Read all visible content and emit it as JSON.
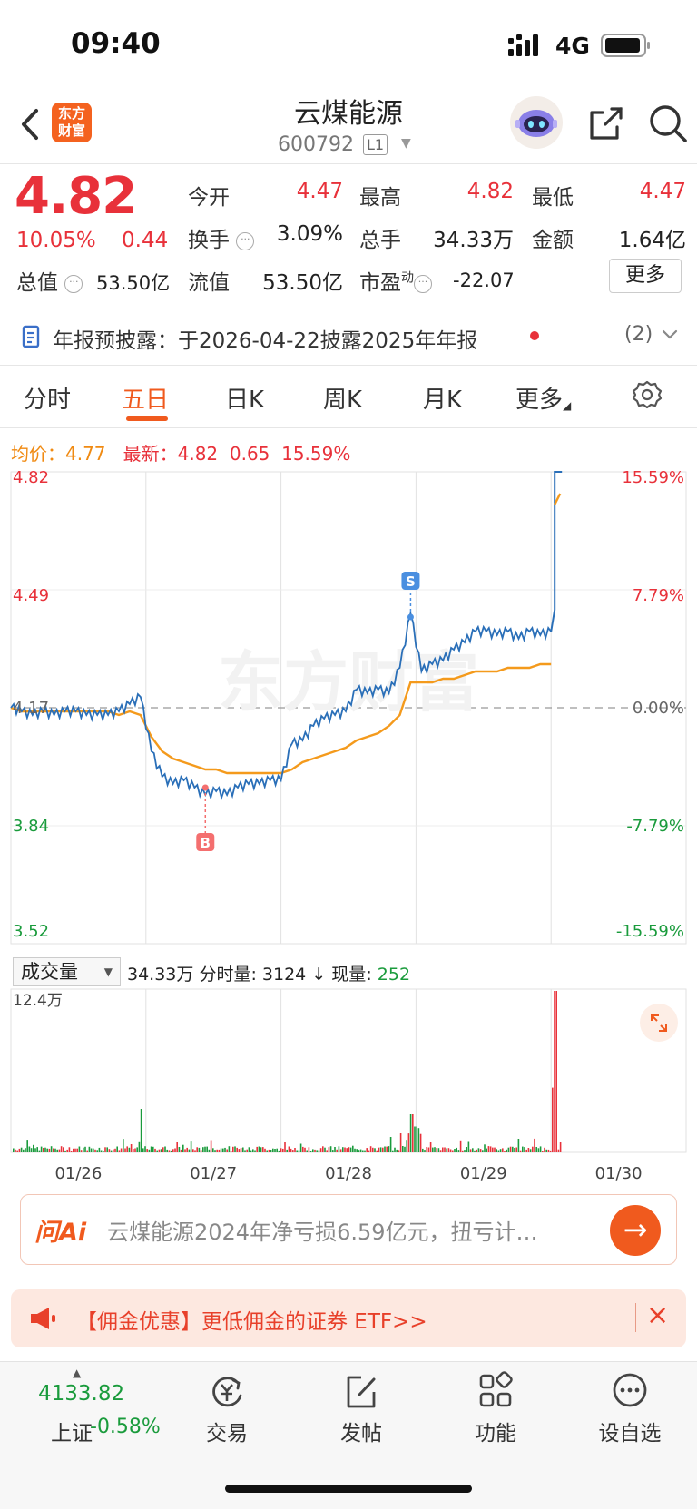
{
  "status_bar": {
    "time": "09:40",
    "network": "4G"
  },
  "header": {
    "logo_text": "东方财富",
    "stock_name": "云煤能源",
    "stock_code": "600792",
    "level": "L1"
  },
  "quote": {
    "price": "4.82",
    "change_pct": "10.05%",
    "change_amt": "0.44",
    "rows": [
      [
        {
          "label": "今开",
          "value": "4.47",
          "color": "red"
        },
        {
          "label": "最高",
          "value": "4.82",
          "color": "red"
        },
        {
          "label": "最低",
          "value": "4.47",
          "color": "red"
        }
      ],
      [
        {
          "label": "换手",
          "value": "3.09%",
          "color": "dark"
        },
        {
          "label": "总手",
          "value": "34.33万",
          "color": "dark"
        },
        {
          "label": "金额",
          "value": "1.64亿",
          "color": "dark"
        }
      ]
    ],
    "market_cap_label": "总值",
    "market_cap": "53.50亿",
    "float_cap_label": "流值",
    "float_cap": "53.50亿",
    "pe_label": "市盈",
    "pe_sup": "动",
    "pe": "-22.07",
    "more_label": "更多"
  },
  "notice": {
    "text": "年报预披露：于2026-04-22披露2025年年报",
    "count": "(2)"
  },
  "tabs": [
    "分时",
    "五日",
    "日K",
    "周K",
    "月K",
    "更多"
  ],
  "active_tab": "五日",
  "chart_legend": {
    "avg_label": "均价：",
    "avg_value": "4.77",
    "latest_label": "最新：",
    "latest_value": "4.82",
    "latest_change": "0.65",
    "latest_pct": "15.59%"
  },
  "colors": {
    "price_line": "#2a6fb8",
    "avg_line": "#f49a1c",
    "up": "#e8313a",
    "down": "#1a9b3c",
    "accent": "#f05a1e"
  },
  "chart_data": {
    "type": "line",
    "title": "",
    "x_dates": [
      "01/26",
      "01/27",
      "01/28",
      "01/29",
      "01/30"
    ],
    "y_ticks_left": [
      "4.82",
      "4.49",
      "4.17",
      "3.84",
      "3.52"
    ],
    "y_ticks_right": [
      "15.59%",
      "7.79%",
      "0.00%",
      "-7.79%",
      "-15.59%"
    ],
    "ylim": [
      3.52,
      4.82
    ],
    "prev_close": 4.17,
    "series": [
      {
        "name": "均价",
        "values": [
          4.17,
          4.16,
          4.16,
          4.16,
          4.16,
          4.16,
          4.16,
          4.16,
          4.16,
          4.16,
          4.15,
          4.16,
          4.15,
          4.09,
          4.05,
          4.03,
          4.02,
          4.01,
          4.0,
          4.0,
          3.99,
          3.99,
          3.99,
          3.99,
          3.99,
          3.99,
          4.0,
          4.02,
          4.03,
          4.04,
          4.05,
          4.06,
          4.08,
          4.09,
          4.1,
          4.12,
          4.15,
          4.24,
          4.24,
          4.24,
          4.25,
          4.25,
          4.26,
          4.27,
          4.27,
          4.27,
          4.28,
          4.28,
          4.28,
          4.29,
          4.29
        ]
      },
      {
        "name": "最新",
        "values": [
          4.17,
          4.16,
          4.15,
          4.16,
          4.15,
          4.16,
          4.16,
          4.15,
          4.15,
          4.15,
          4.16,
          4.18,
          4.2,
          4.05,
          3.98,
          3.96,
          3.97,
          3.95,
          3.93,
          3.94,
          3.93,
          3.95,
          3.96,
          3.96,
          3.97,
          3.97,
          4.07,
          4.08,
          4.12,
          4.14,
          4.15,
          4.16,
          4.22,
          4.21,
          4.22,
          4.21,
          4.28,
          4.43,
          4.27,
          4.29,
          4.3,
          4.33,
          4.35,
          4.38,
          4.38,
          4.37,
          4.38,
          4.36,
          4.38,
          4.37,
          4.38,
          4.82
        ]
      }
    ],
    "markers": [
      {
        "label": "B",
        "price": 3.95
      },
      {
        "label": "S",
        "price": 4.42
      }
    ],
    "volume": {
      "label": "成交量",
      "total": "34.33万",
      "tick_label": "分时量",
      "tick_value": "3124",
      "tick_dir": "↓",
      "now_label": "现量",
      "now_value": "252",
      "max_label": "12.4万"
    }
  },
  "ai_search": {
    "logo": "问Ai",
    "text": "云煤能源2024年净亏损6.59亿元，扭亏计…"
  },
  "promo": {
    "text": "【佣金优惠】更低佣金的证券 ETF>>"
  },
  "bottom_nav": {
    "index_value": "4133.82",
    "index_name": "上证",
    "index_change": "-0.58%",
    "items": [
      "交易",
      "发帖",
      "功能",
      "设自选"
    ]
  }
}
